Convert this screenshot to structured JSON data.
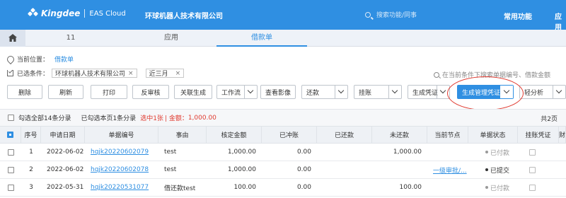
{
  "header": {
    "brand": "Kingdee",
    "product": "EAS Cloud",
    "company": "环球机器人技术有限公司",
    "search_placeholder": "搜索功能/同事",
    "links": [
      "常用功能",
      "应用"
    ]
  },
  "tabs": [
    {
      "label": "11",
      "active": false
    },
    {
      "label": "应用",
      "active": false
    },
    {
      "label": "借款单",
      "active": true
    }
  ],
  "breadcrumb": {
    "label": "当前位置：",
    "current": "借款单"
  },
  "filters": {
    "label": "已选条件：",
    "chips": [
      "环球机器人技术有限公司",
      "近三月"
    ],
    "search_placeholder": "在当前条件下搜索单据编号、借款金额"
  },
  "toolbar": {
    "buttons": [
      "删除",
      "刷新",
      "打印",
      "反审核",
      "关联生成"
    ],
    "workflow": "工作流",
    "view_image": "查看影像",
    "repay": "还款",
    "hang": "挂账",
    "gen_voucher": "生成凭证",
    "gen_mgmt_voucher": "生成管理凭证",
    "analysis": "轻分析"
  },
  "summary": {
    "select_all": "勾选全部14条分录",
    "selected_page": "已勾选本页1条分录",
    "selected_prefix": "选中1张",
    "amount_label": "| 金额：",
    "amount": "1,000.00",
    "page_info": "共2页"
  },
  "table": {
    "columns": [
      "序号",
      "申请日期",
      "单据编号",
      "事由",
      "核定金额",
      "已冲账",
      "已还款",
      "未还款",
      "当前节点",
      "单据状态",
      "挂账凭证",
      "财"
    ],
    "rows": [
      {
        "seq": "1",
        "date": "2022-06-02",
        "number": "hqjk20220602079",
        "reason": "test",
        "approved": "1,000.00",
        "offset": "0.00",
        "repaid": "",
        "unpaid": "1,000.00",
        "node": "",
        "status": "已付款",
        "status_style": "muted"
      },
      {
        "seq": "2",
        "date": "2022-06-02",
        "number": "hqjk20220602078",
        "reason": "test",
        "approved": "1,000.00",
        "offset": "0.00",
        "repaid": "",
        "unpaid": "",
        "node": "一级审批/...",
        "status": "已提交",
        "status_style": "dark"
      },
      {
        "seq": "3",
        "date": "2022-05-31",
        "number": "hqjk20220531077",
        "reason": "借还款test",
        "approved": "100.00",
        "offset": "0.00",
        "repaid": "",
        "unpaid": "100.00",
        "node": "",
        "status": "已付款",
        "status_style": "muted"
      }
    ]
  },
  "colors": {
    "brand_blue": "#2f8fe2",
    "highlight_red": "#e0392f"
  }
}
